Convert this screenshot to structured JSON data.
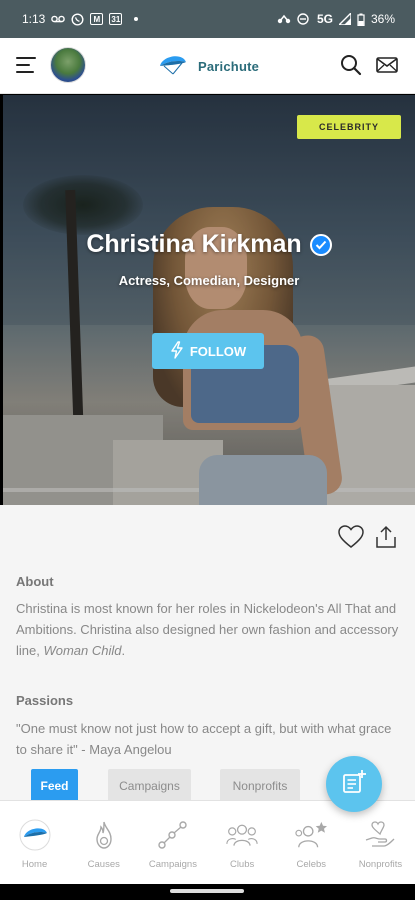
{
  "status_bar": {
    "time": "1:13",
    "network": "5G",
    "battery": "36%",
    "left_icons": [
      "voicemail-icon",
      "whatsapp-icon",
      "gmail-icon",
      "calendar-icon",
      "dot-icon"
    ],
    "right_icons": [
      "link-icon",
      "do-not-disturb-icon",
      "signal-icon",
      "battery-icon"
    ]
  },
  "header": {
    "brand_name": "Parichute",
    "icons": [
      "menu-icon",
      "avatar",
      "parichute-logo-icon",
      "search-icon",
      "mail-icon"
    ]
  },
  "profile": {
    "badge": "CELEBRITY",
    "name": "Christina Kirkman",
    "subtitle": "Actress, Comedian, Designer",
    "follow_label": "FOLLOW",
    "verified": true
  },
  "about": {
    "heading": "About",
    "text": "Christina is most known for her roles in Nickelodeon's All That and Ambitions. Christina also designed her own fashion and accessory line, ",
    "text_italic": "Woman Child",
    "text_end": "."
  },
  "passions": {
    "heading": "Passions",
    "quote": "\"One must know not just how to accept a gift, but with what grace to share it\" - Maya Angelou"
  },
  "tabs": [
    {
      "label": "Feed",
      "active": true
    },
    {
      "label": "Campaigns",
      "active": false
    },
    {
      "label": "Nonprofits",
      "active": false
    }
  ],
  "bottom_nav": [
    {
      "label": "Home",
      "icon": "home-icon"
    },
    {
      "label": "Causes",
      "icon": "causes-icon"
    },
    {
      "label": "Campaigns",
      "icon": "campaigns-icon"
    },
    {
      "label": "Clubs",
      "icon": "clubs-icon"
    },
    {
      "label": "Celebs",
      "icon": "celebs-icon"
    },
    {
      "label": "Nonprofits",
      "icon": "nonprofits-icon"
    }
  ],
  "colors": {
    "accent": "#5cc4ee",
    "badge": "#d8e84a",
    "tab_active": "#2b9cf0",
    "status_bar": "#4b5b60",
    "brand_text": "#2b6c7a"
  }
}
